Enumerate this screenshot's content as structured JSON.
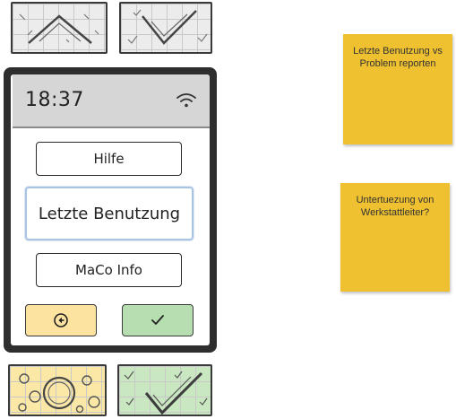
{
  "device": {
    "clock": "18:37",
    "buttons": {
      "help": "Hilfe",
      "last_usage": "Letzte Benutzung",
      "maco_info": "MaCo Info"
    },
    "icons": {
      "wifi": "wifi-icon",
      "back": "back-arrow-circle-icon",
      "confirm": "checkmark-icon"
    },
    "colors": {
      "back_button": "#fde3a0",
      "confirm_button": "#b6deb0",
      "device_frame": "#2e2e2e",
      "status_bar": "#d6d6d6"
    }
  },
  "notes": [
    {
      "text": "Letzte Benutzung vs Problem reporten"
    },
    {
      "text": "Untertuezung von Werkstattleiter?"
    }
  ],
  "note_color": "#efc02f"
}
